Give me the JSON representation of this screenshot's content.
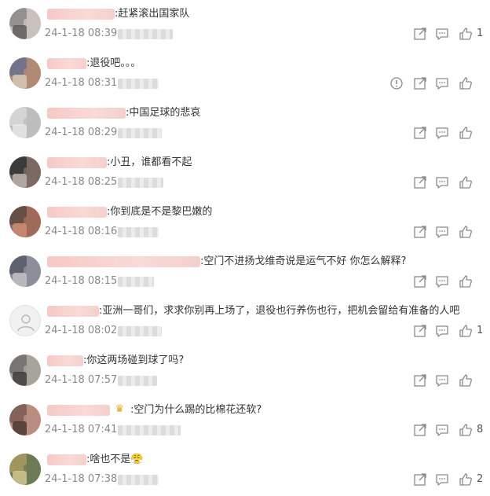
{
  "comments": [
    {
      "text": ":赶紧滚出国家队",
      "time": "24-1-18 08:39",
      "likes": "1",
      "report": false,
      "avatar_colors": [
        "#8a8a8a",
        "#c8c1bd",
        "#5d5a58"
      ]
    },
    {
      "text": ":退役吧。。。",
      "time": "24-1-18 08:31",
      "likes": "",
      "report": true,
      "avatar_colors": [
        "#6a6e8e",
        "#b08a74",
        "#d7c7b5"
      ]
    },
    {
      "text": ":中国足球的悲哀",
      "time": "24-1-18 08:29",
      "likes": "",
      "report": false,
      "avatar_colors": [
        "#d8d8d8",
        "#bdbdbd",
        "#e8e8e8"
      ]
    },
    {
      "text": ":小丑，谁都看不起",
      "time": "24-1-18 08:25",
      "likes": "",
      "report": false,
      "avatar_colors": [
        "#333333",
        "#7a6a62",
        "#b9b0ab"
      ]
    },
    {
      "text": ":你到底是不是黎巴嫩的",
      "time": "24-1-18 08:16",
      "likes": "",
      "report": false,
      "avatar_colors": [
        "#5b4a44",
        "#a06a5a",
        "#c98c73"
      ]
    },
    {
      "text": ":空门不进扬戈维奇说是运气不好 你怎么解释?",
      "time": "24-1-18 08:15",
      "likes": "",
      "report": false,
      "avatar_colors": [
        "#555a66",
        "#8c8f9a",
        "#c2c0c6"
      ]
    },
    {
      "text": ":亚洲一哥们，求求你别再上场了，退役也行养伤也行，把机会留给有准备的人吧",
      "time": "24-1-18 08:02",
      "likes": "1",
      "report": false,
      "avatar_colors": []
    },
    {
      "text": ":你这两场碰到球了吗?",
      "time": "24-1-18 07:57",
      "likes": "",
      "report": false,
      "avatar_colors": [
        "#6e6f6c",
        "#a7a49c",
        "#3e3c3a"
      ]
    },
    {
      "text": ":空门为什么踢的比棉花还软?",
      "time": "24-1-18 07:41",
      "likes": "8",
      "report": false,
      "crown": true,
      "avatar_colors": [
        "#7d5c52",
        "#b98d7f",
        "#4a3833"
      ]
    },
    {
      "text": ":啥也不是😤",
      "time": "24-1-18 07:38",
      "likes": "2",
      "report": false,
      "avatar_colors": [
        "#a99a5e",
        "#6d7a56",
        "#d2c58e"
      ]
    }
  ]
}
